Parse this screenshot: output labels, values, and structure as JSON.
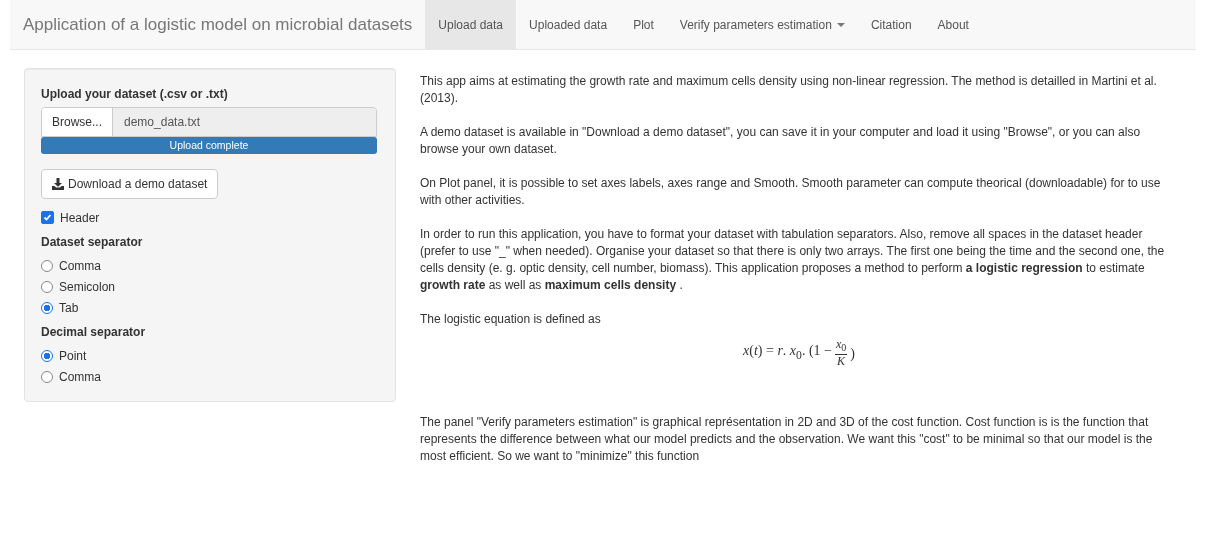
{
  "navbar": {
    "brand": "Application of a logistic model on microbial datasets",
    "tabs": [
      {
        "label": "Upload data",
        "selected": true,
        "dropdown": false
      },
      {
        "label": "Uploaded data",
        "selected": false,
        "dropdown": false
      },
      {
        "label": "Plot",
        "selected": false,
        "dropdown": false
      },
      {
        "label": "Verify parameters estimation",
        "selected": false,
        "dropdown": true
      },
      {
        "label": "Citation",
        "selected": false,
        "dropdown": false
      },
      {
        "label": "About",
        "selected": false,
        "dropdown": false
      }
    ]
  },
  "sidebar": {
    "upload_label": "Upload your dataset (.csv or .txt)",
    "browse_button": "Browse...",
    "file_name": "demo_data.txt",
    "progress": {
      "label": "Upload complete",
      "level": 1
    },
    "download_button": "Download a demo dataset",
    "header_checkbox": {
      "label": "Header",
      "checked": true
    },
    "radio_groups": [
      {
        "title": "Dataset separator",
        "options": [
          {
            "label": "Comma",
            "selected": false
          },
          {
            "label": "Semicolon",
            "selected": false
          },
          {
            "label": "Tab",
            "selected": true
          }
        ]
      },
      {
        "title": "Decimal separator",
        "options": [
          {
            "label": "Point",
            "selected": true
          },
          {
            "label": "Comma",
            "selected": false
          }
        ]
      }
    ]
  },
  "main": {
    "paragraphs": [
      "This app aims at estimating the growth rate and maximum cells density using non-linear regression. The method is detailled in Martini et al. (2013).",
      "A demo dataset is available in \"Download a demo dataset\", you can save it in your computer and load it using \"Browse\", or you can also browse your own dataset.",
      "On Plot panel, it is possible to set axes labels, axes range and Smooth. Smooth parameter can compute theorical (downloadable) for to use with other activities.",
      "In order to run this application, you have to format your dataset with tabulation separators. Also, remove all spaces in the dataset header (prefer to use \"_\" when needed). Organise your dataset so that there is only two arrays. The first one being the time and the second one, the cells density (e. g. optic density, cell number, biomass). This application proposes a method to perform **a logistic regression** to estimate **growth rate** as well as **maximum cells density** ."
    ],
    "equation_intro": "The logistic equation is defined as",
    "equation": {
      "lhs": "*x*(*t*) = *r*. *x*$_{0}$. (1 −",
      "numerator": "*x*$_{0}$",
      "denominator": "*K*",
      "close": ")"
    },
    "closing": "The panel \"Verify parameters estimation\" is graphical représentation in 2D and 3D of the cost function. Cost function is is the function that represents the difference between what our model predicts and the observation. We want this \"cost\" to be minimal so that our model is the most efficient. So we want to \"minimize\" this function"
  }
}
